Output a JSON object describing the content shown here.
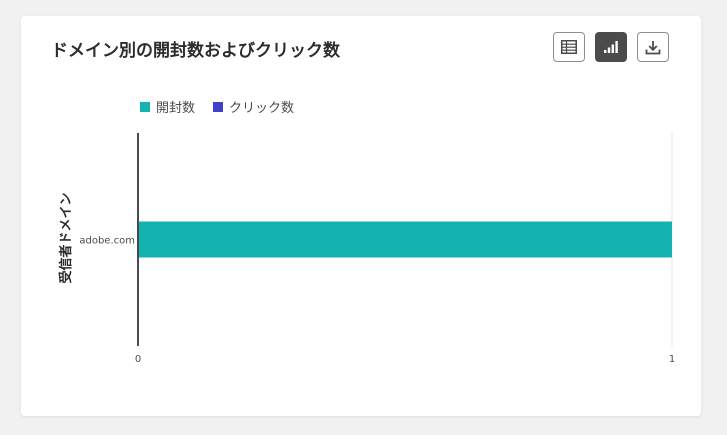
{
  "card": {
    "title": "ドメイン別の開封数およびクリック数"
  },
  "toolbar": {
    "buttons": [
      {
        "name": "table-view-button",
        "icon": "table-icon",
        "active": false
      },
      {
        "name": "chart-view-button",
        "icon": "bar-chart-icon",
        "active": true
      },
      {
        "name": "download-button",
        "icon": "download-icon",
        "active": false
      }
    ]
  },
  "legend": {
    "items": [
      {
        "label": "開封数",
        "color": "#12b3b0"
      },
      {
        "label": "クリック数",
        "color": "#3f41c9"
      }
    ]
  },
  "chart_data": {
    "type": "bar",
    "orientation": "horizontal",
    "title": "ドメイン別の開封数およびクリック数",
    "ylabel": "受信者ドメイン",
    "xlabel": "",
    "categories": [
      "adobe.com"
    ],
    "series": [
      {
        "name": "開封数",
        "values": [
          1
        ],
        "color": "#12b3b0"
      },
      {
        "name": "クリック数",
        "values": [
          0
        ],
        "color": "#3f41c9"
      }
    ],
    "xlim": [
      0,
      1
    ],
    "x_ticks": [
      "0",
      "1"
    ],
    "legend": "top-left",
    "grid": false
  }
}
